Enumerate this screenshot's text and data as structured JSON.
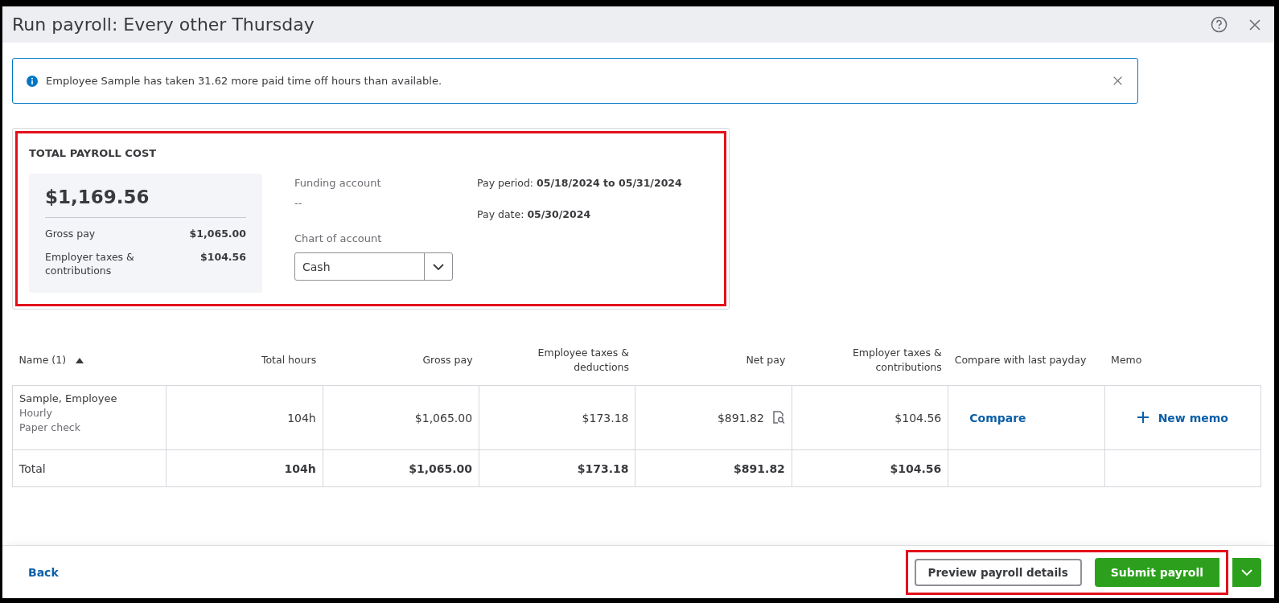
{
  "window": {
    "title": "Run payroll: Every other Thursday"
  },
  "alert": {
    "message": "Employee Sample has taken 31.62 more paid time off hours than available."
  },
  "summary": {
    "highlighted": true,
    "heading": "TOTAL PAYROLL COST",
    "total": "$1,169.56",
    "lines": [
      {
        "label": "Gross pay",
        "value": "$1,065.00"
      },
      {
        "label": "Employer taxes & contributions",
        "value": "$104.56"
      }
    ],
    "funding_account": {
      "label": "Funding account",
      "value": "--"
    },
    "chart_of_account": {
      "label": "Chart of account",
      "value": "Cash"
    },
    "pay_period": {
      "label": "Pay period:",
      "value": "05/18/2024 to 05/31/2024"
    },
    "pay_date": {
      "label": "Pay date:",
      "value": "05/30/2024"
    }
  },
  "table": {
    "columns": [
      "Name (1)",
      "Total hours",
      "Gross pay",
      "Employee taxes & deductions",
      "Net pay",
      "Employer taxes & contributions",
      "Compare with last payday",
      "Memo"
    ],
    "rows": [
      {
        "name": "Sample, Employee",
        "pay_type": "Hourly",
        "pay_method": "Paper check",
        "total_hours": "104h",
        "gross_pay": "$1,065.00",
        "employee_taxes": "$173.18",
        "net_pay": "$891.82",
        "employer_taxes": "$104.56",
        "compare": "Compare",
        "memo": "New memo"
      }
    ],
    "total": {
      "label": "Total",
      "total_hours": "104h",
      "gross_pay": "$1,065.00",
      "employee_taxes": "$173.18",
      "net_pay": "$891.82",
      "employer_taxes": "$104.56"
    }
  },
  "footer": {
    "back": "Back",
    "actions_highlighted": true,
    "preview": "Preview payroll details",
    "submit": "Submit payroll"
  }
}
